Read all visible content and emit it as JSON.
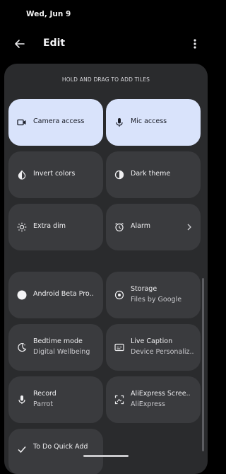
{
  "status_bar": {
    "date": "Wed, Jun 9"
  },
  "top_bar": {
    "title": "Edit",
    "back_icon": "arrow-left-icon",
    "menu_icon": "more-vert-icon"
  },
  "panel": {
    "hint": "HOLD AND DRAG TO ADD TILES"
  },
  "active_tiles": [
    {
      "label": "Camera access",
      "icon": "camera-icon",
      "active": true
    },
    {
      "label": "Mic access",
      "icon": "mic-icon",
      "active": true
    },
    {
      "label": "Invert colors",
      "icon": "invert-colors-icon"
    },
    {
      "label": "Dark theme",
      "icon": "dark-theme-icon"
    },
    {
      "label": "Extra dim",
      "icon": "extra-dim-icon"
    },
    {
      "label": "Alarm",
      "icon": "alarm-icon",
      "chevron": true
    }
  ],
  "available_tiles": [
    {
      "label": "Android Beta Pro..",
      "icon": "circle-icon"
    },
    {
      "label": "Storage",
      "sub": "Files by Google",
      "icon": "storage-icon"
    },
    {
      "label": "Bedtime mode",
      "sub": "Digital Wellbeing",
      "icon": "bedtime-icon"
    },
    {
      "label": "Live Caption",
      "sub": "Device Personaliz..",
      "icon": "live-caption-icon"
    },
    {
      "label": "Record",
      "sub": "Parrot",
      "icon": "mic-icon"
    },
    {
      "label": "AliExpress Scree..",
      "sub": "AliExpress",
      "icon": "screenshot-icon"
    },
    {
      "label": "To Do Quick Add",
      "icon": "check-icon"
    }
  ],
  "colors": {
    "background": "#000000",
    "panel": "#2a2b2d",
    "tile": "#3a3b3e",
    "tile_active": "#d9e3fb"
  }
}
